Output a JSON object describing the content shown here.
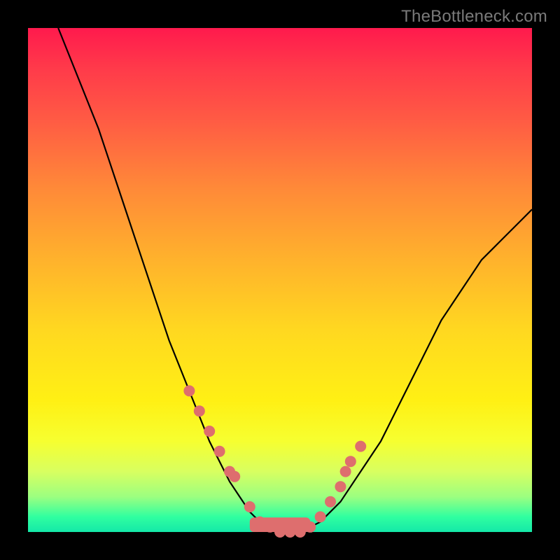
{
  "watermark": "TheBottleneck.com",
  "chart_data": {
    "type": "line",
    "title": "",
    "xlabel": "",
    "ylabel": "",
    "xlim": [
      0,
      100
    ],
    "ylim": [
      0,
      100
    ],
    "series": [
      {
        "name": "curve",
        "color": "#000000",
        "x": [
          6,
          8,
          10,
          12,
          14,
          16,
          18,
          20,
          22,
          24,
          26,
          28,
          30,
          32,
          34,
          36,
          38,
          40,
          42,
          44,
          46,
          48,
          50,
          52,
          54,
          56,
          58,
          60,
          62,
          64,
          66,
          68,
          70,
          72,
          74,
          76,
          78,
          80,
          82,
          84,
          86,
          88,
          90,
          92,
          94,
          96,
          98,
          100
        ],
        "y": [
          100,
          95,
          90,
          85,
          80,
          74,
          68,
          62,
          56,
          50,
          44,
          38,
          33,
          28,
          23,
          18,
          14,
          10,
          7,
          4,
          2,
          1,
          0,
          0,
          0,
          1,
          2,
          4,
          6,
          9,
          12,
          15,
          18,
          22,
          26,
          30,
          34,
          38,
          42,
          45,
          48,
          51,
          54,
          56,
          58,
          60,
          62,
          64
        ]
      },
      {
        "name": "cluster-dots",
        "type": "scatter",
        "color": "#de6e6e",
        "x": [
          32,
          34,
          36,
          38,
          40,
          41,
          44,
          46,
          48,
          50,
          52,
          54,
          56,
          58,
          60,
          62,
          63,
          64,
          66
        ],
        "y": [
          28,
          24,
          20,
          16,
          12,
          11,
          5,
          2,
          1,
          0,
          0,
          0,
          1,
          3,
          6,
          9,
          12,
          14,
          17
        ]
      }
    ],
    "bottom_bar": {
      "color": "#de6e6e",
      "x_start": 44,
      "x_end": 56,
      "y": 0,
      "height_pct": 1.5
    }
  },
  "colors": {
    "frame": "#000000",
    "curve": "#000000",
    "dots": "#de6e6e"
  }
}
